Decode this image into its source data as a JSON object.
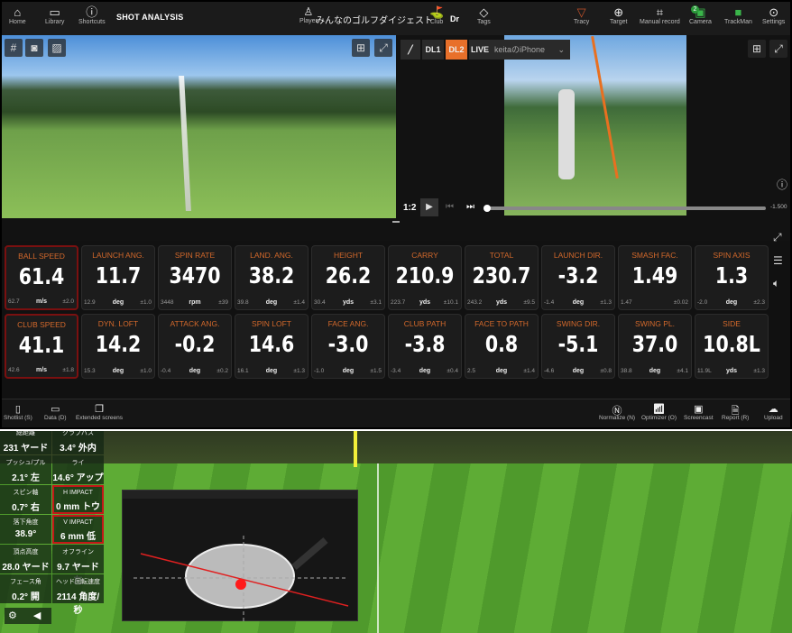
{
  "topbar": {
    "left": [
      {
        "icon": "home-icon",
        "label": "Home"
      },
      {
        "icon": "folder-icon",
        "label": "Library"
      },
      {
        "icon": "question-icon",
        "label": "Shortcuts"
      }
    ],
    "title": "SHOT ANALYSIS",
    "player_label": "Player",
    "player_name": "みんなのゴルフダイジェスト",
    "club_label": "Club",
    "club_value": "Dr",
    "tags_label": "Tags",
    "right": [
      {
        "icon": "tracy-icon",
        "label": "Tracy"
      },
      {
        "icon": "target-icon",
        "label": "Target"
      },
      {
        "icon": "manual-record-icon",
        "label": "Manual record"
      },
      {
        "icon": "camera-icon",
        "label": "Camera",
        "badge": "2"
      },
      {
        "icon": "trackman-icon",
        "label": "TrackMan"
      },
      {
        "icon": "settings-icon",
        "label": "Settings"
      }
    ]
  },
  "video": {
    "dl1": "DL1",
    "dl2": "DL2",
    "live": "LIVE",
    "device": "keitaのiPhone",
    "speed": "1:2",
    "time": "-1.500"
  },
  "tiles": [
    {
      "label": "BALL SPEED",
      "value": "61.4",
      "avg": "62.7",
      "unit": "m/s",
      "dev": "±2.0",
      "highlight": true
    },
    {
      "label": "LAUNCH ANG.",
      "value": "11.7",
      "avg": "12.9",
      "unit": "deg",
      "dev": "±1.0"
    },
    {
      "label": "SPIN RATE",
      "value": "3470",
      "avg": "3448",
      "unit": "rpm",
      "dev": "±39"
    },
    {
      "label": "LAND. ANG.",
      "value": "38.2",
      "avg": "39.8",
      "unit": "deg",
      "dev": "±1.4"
    },
    {
      "label": "HEIGHT",
      "value": "26.2",
      "avg": "30.4",
      "unit": "yds",
      "dev": "±3.1"
    },
    {
      "label": "CARRY",
      "value": "210.9",
      "avg": "223.7",
      "unit": "yds",
      "dev": "±10.1"
    },
    {
      "label": "TOTAL",
      "value": "230.7",
      "avg": "243.2",
      "unit": "yds",
      "dev": "±9.5"
    },
    {
      "label": "LAUNCH DIR.",
      "value": "-3.2",
      "avg": "-1.4",
      "unit": "deg",
      "dev": "±1.3"
    },
    {
      "label": "SMASH FAC.",
      "value": "1.49",
      "avg": "1.47",
      "unit": "",
      "dev": "±0.02"
    },
    {
      "label": "SPIN AXIS",
      "value": "1.3",
      "avg": "-2.0",
      "unit": "deg",
      "dev": "±2.3"
    },
    {
      "label": "CLUB SPEED",
      "value": "41.1",
      "avg": "42.6",
      "unit": "m/s",
      "dev": "±1.8",
      "highlight": true
    },
    {
      "label": "DYN. LOFT",
      "value": "14.2",
      "avg": "15.3",
      "unit": "deg",
      "dev": "±1.0"
    },
    {
      "label": "ATTACK ANG.",
      "value": "-0.2",
      "avg": "-0.4",
      "unit": "deg",
      "dev": "±0.2"
    },
    {
      "label": "SPIN LOFT",
      "value": "14.6",
      "avg": "16.1",
      "unit": "deg",
      "dev": "±1.3"
    },
    {
      "label": "FACE ANG.",
      "value": "-3.0",
      "avg": "-1.0",
      "unit": "deg",
      "dev": "±1.5"
    },
    {
      "label": "CLUB PATH",
      "value": "-3.8",
      "avg": "-3.4",
      "unit": "deg",
      "dev": "±0.4"
    },
    {
      "label": "FACE TO PATH",
      "value": "0.8",
      "avg": "2.5",
      "unit": "deg",
      "dev": "±1.4"
    },
    {
      "label": "SWING DIR.",
      "value": "-5.1",
      "avg": "-4.6",
      "unit": "deg",
      "dev": "±0.8"
    },
    {
      "label": "SWING PL.",
      "value": "37.0",
      "avg": "38.8",
      "unit": "deg",
      "dev": "±4.1"
    },
    {
      "label": "SIDE",
      "value": "10.8L",
      "avg": "11.9L",
      "unit": "yds",
      "dev": "±1.3"
    }
  ],
  "bottombar": {
    "left": [
      {
        "icon": "shotlist-icon",
        "label": "Shotlist (S)"
      },
      {
        "icon": "data-icon",
        "label": "Data (D)"
      },
      {
        "icon": "extended-screens-icon",
        "label": "Extended screens"
      }
    ],
    "right": [
      {
        "icon": "normalize-icon",
        "label": "Normalize (N)"
      },
      {
        "icon": "optimizer-icon",
        "label": "Optimizer (O)"
      },
      {
        "icon": "screencast-icon",
        "label": "Screencast"
      },
      {
        "icon": "report-icon",
        "label": "Report (R)"
      },
      {
        "icon": "upload-icon",
        "label": "Upload"
      }
    ]
  },
  "sim_panel": [
    {
      "label": "総距離",
      "value": "231 ヤード"
    },
    {
      "label": "クラブパス",
      "value": "3.4° 外内"
    },
    {
      "label": "プッシュ/プル",
      "value": "2.1° 左"
    },
    {
      "label": "ライ",
      "value": "14.6° アップ"
    },
    {
      "label": "スピン軸",
      "value": "0.7° 右"
    },
    {
      "label": "H IMPACT",
      "value": "0 mm トウ",
      "highlight": true
    },
    {
      "label": "落下角度",
      "value": "38.9°"
    },
    {
      "label": "V IMPACT",
      "value": "6 mm 低",
      "highlight": true
    },
    {
      "label": "頂点高度",
      "value": "28.0 ヤード"
    },
    {
      "label": "オフライン",
      "value": "9.7 ヤード 左"
    },
    {
      "label": "フェース角",
      "value": "0.2° 開"
    },
    {
      "label": "ヘッド回転速度",
      "value": "2114 角度/秒"
    }
  ],
  "colors": {
    "accent": "#e8702a",
    "label": "#d2682b",
    "highlight": "#7a1010",
    "sim_highlight": "#c41818"
  }
}
